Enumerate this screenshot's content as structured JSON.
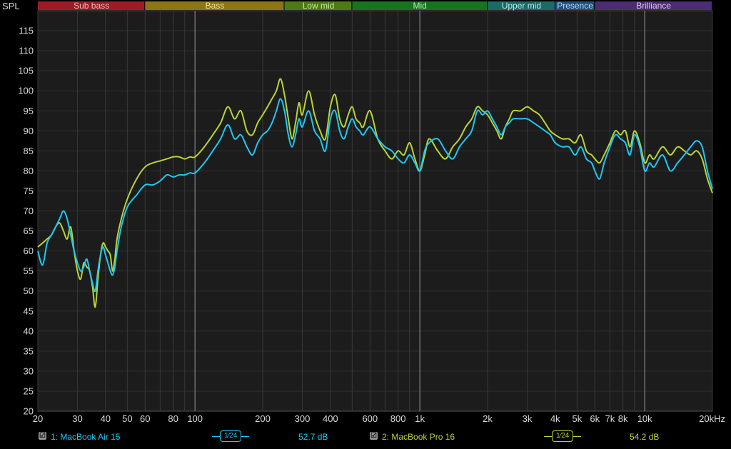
{
  "colors": {
    "series1": "#1fc7f5",
    "series2": "#b8d433",
    "background": "#000000",
    "plot_background": "#1c1c1c",
    "axis_text": "#d8d8d8"
  },
  "bands": [
    {
      "label": "Sub bass",
      "from": 20,
      "to": 60,
      "color": "#9e1a26",
      "text_color": "#e3c0c0"
    },
    {
      "label": "Bass",
      "from": 60,
      "to": 250,
      "color": "#8b7514",
      "text_color": "#f0e1a0"
    },
    {
      "label": "Low mid",
      "from": 250,
      "to": 500,
      "color": "#4e7a14",
      "text_color": "#cfe4a8"
    },
    {
      "label": "Mid",
      "from": 500,
      "to": 2000,
      "color": "#17741f",
      "text_color": "#bfe5c1"
    },
    {
      "label": "Upper mid",
      "from": 2000,
      "to": 4000,
      "color": "#1b6a66",
      "text_color": "#bfe6e4"
    },
    {
      "label": "Presence",
      "from": 4000,
      "to": 6000,
      "color": "#1f4e7e",
      "text_color": "#c3d8ef"
    },
    {
      "label": "Brilliance",
      "from": 6000,
      "to": 20000,
      "color": "#4a2d72",
      "text_color": "#d9c9ee"
    }
  ],
  "legend": {
    "items": [
      {
        "checkbox": "☑",
        "name": "1: MacBook Air 15",
        "smoothing_num": "1",
        "smoothing_den": "24",
        "value": "52.7 dB"
      },
      {
        "checkbox": "☑",
        "name": "2: MacBook Pro 16",
        "smoothing_num": "1",
        "smoothing_den": "24",
        "value": "54.2 dB"
      }
    ]
  },
  "chart_data": {
    "type": "line",
    "ylabel": "SPL",
    "xscale": "log",
    "xlim": [
      20,
      20000
    ],
    "ylim": [
      20,
      120
    ],
    "grid": true,
    "x_tick_labels": [
      {
        "x": 20,
        "label": "20"
      },
      {
        "x": 30,
        "label": "30"
      },
      {
        "x": 40,
        "label": "40"
      },
      {
        "x": 50,
        "label": "50"
      },
      {
        "x": 60,
        "label": "60"
      },
      {
        "x": 80,
        "label": "80"
      },
      {
        "x": 100,
        "label": "100"
      },
      {
        "x": 200,
        "label": "200"
      },
      {
        "x": 300,
        "label": "300"
      },
      {
        "x": 400,
        "label": "400"
      },
      {
        "x": 600,
        "label": "600"
      },
      {
        "x": 800,
        "label": "800"
      },
      {
        "x": 1000,
        "label": "1k"
      },
      {
        "x": 2000,
        "label": "2k"
      },
      {
        "x": 3000,
        "label": "3k"
      },
      {
        "x": 4000,
        "label": "4k"
      },
      {
        "x": 5000,
        "label": "5k"
      },
      {
        "x": 6000,
        "label": "6k"
      },
      {
        "x": 7000,
        "label": "7k"
      },
      {
        "x": 8000,
        "label": "8k"
      },
      {
        "x": 10000,
        "label": "10k"
      },
      {
        "x": 20000,
        "label": "20kHz"
      }
    ],
    "y_ticks": [
      20,
      25,
      30,
      35,
      40,
      45,
      50,
      55,
      60,
      65,
      70,
      75,
      80,
      85,
      90,
      95,
      100,
      105,
      110,
      115
    ],
    "series": [
      {
        "name": "1: MacBook Air 15",
        "color": "#1fc7f5",
        "points": [
          [
            20,
            60
          ],
          [
            21,
            56.5
          ],
          [
            22,
            62
          ],
          [
            23,
            64
          ],
          [
            24,
            66
          ],
          [
            25,
            68
          ],
          [
            26,
            70
          ],
          [
            27,
            68
          ],
          [
            28,
            64
          ],
          [
            29,
            60
          ],
          [
            30,
            57
          ],
          [
            31,
            55
          ],
          [
            32,
            56
          ],
          [
            33,
            58
          ],
          [
            34,
            55
          ],
          [
            35,
            52
          ],
          [
            36,
            50
          ],
          [
            37,
            55
          ],
          [
            38,
            59
          ],
          [
            39,
            61
          ],
          [
            40,
            59
          ],
          [
            41,
            57
          ],
          [
            42,
            55
          ],
          [
            43,
            54
          ],
          [
            44,
            56
          ],
          [
            45,
            60
          ],
          [
            47,
            66
          ],
          [
            50,
            71
          ],
          [
            55,
            74
          ],
          [
            60,
            76.5
          ],
          [
            65,
            76.5
          ],
          [
            70,
            77.5
          ],
          [
            75,
            79
          ],
          [
            80,
            78.5
          ],
          [
            85,
            79
          ],
          [
            90,
            79
          ],
          [
            95,
            79.5
          ],
          [
            100,
            79.5
          ],
          [
            110,
            82
          ],
          [
            120,
            85
          ],
          [
            130,
            88
          ],
          [
            140,
            91.5
          ],
          [
            150,
            88
          ],
          [
            160,
            89
          ],
          [
            170,
            86
          ],
          [
            180,
            84
          ],
          [
            190,
            87
          ],
          [
            200,
            89
          ],
          [
            210,
            90
          ],
          [
            220,
            92
          ],
          [
            230,
            95
          ],
          [
            240,
            98
          ],
          [
            250,
            95
          ],
          [
            260,
            89
          ],
          [
            270,
            86
          ],
          [
            280,
            89
          ],
          [
            290,
            93
          ],
          [
            300,
            91
          ],
          [
            320,
            95
          ],
          [
            340,
            90
          ],
          [
            360,
            88
          ],
          [
            380,
            85
          ],
          [
            400,
            93
          ],
          [
            420,
            95
          ],
          [
            440,
            90
          ],
          [
            460,
            88
          ],
          [
            480,
            91
          ],
          [
            500,
            93
          ],
          [
            520,
            91
          ],
          [
            540,
            90
          ],
          [
            560,
            89
          ],
          [
            600,
            91
          ],
          [
            650,
            88
          ],
          [
            700,
            86
          ],
          [
            750,
            85
          ],
          [
            800,
            83
          ],
          [
            850,
            82
          ],
          [
            900,
            84
          ],
          [
            950,
            82
          ],
          [
            1000,
            80
          ],
          [
            1050,
            85
          ],
          [
            1100,
            87
          ],
          [
            1200,
            88
          ],
          [
            1300,
            85
          ],
          [
            1400,
            83
          ],
          [
            1500,
            86
          ],
          [
            1600,
            88
          ],
          [
            1700,
            90
          ],
          [
            1800,
            95
          ],
          [
            1900,
            94
          ],
          [
            2000,
            95
          ],
          [
            2100,
            93
          ],
          [
            2200,
            91
          ],
          [
            2300,
            89
          ],
          [
            2400,
            91
          ],
          [
            2500,
            92
          ],
          [
            2600,
            93
          ],
          [
            2800,
            93
          ],
          [
            3000,
            93
          ],
          [
            3200,
            92
          ],
          [
            3400,
            91
          ],
          [
            3600,
            90
          ],
          [
            3800,
            89
          ],
          [
            4000,
            87
          ],
          [
            4300,
            86
          ],
          [
            4600,
            86
          ],
          [
            4900,
            84
          ],
          [
            5200,
            86
          ],
          [
            5500,
            83
          ],
          [
            5800,
            82
          ],
          [
            6000,
            80
          ],
          [
            6300,
            78
          ],
          [
            6600,
            82
          ],
          [
            7000,
            86
          ],
          [
            7400,
            89
          ],
          [
            7800,
            88
          ],
          [
            8200,
            87
          ],
          [
            8600,
            84
          ],
          [
            9000,
            89
          ],
          [
            9500,
            86
          ],
          [
            10000,
            80
          ],
          [
            10500,
            82
          ],
          [
            11000,
            81
          ],
          [
            12000,
            84
          ],
          [
            13000,
            80
          ],
          [
            14000,
            82
          ],
          [
            15000,
            84
          ],
          [
            16000,
            86
          ],
          [
            17000,
            87.5
          ],
          [
            18000,
            86
          ],
          [
            19000,
            80
          ],
          [
            20000,
            75.5
          ]
        ]
      },
      {
        "name": "2: MacBook Pro 16",
        "color": "#b8d433",
        "points": [
          [
            20,
            61
          ],
          [
            21,
            62
          ],
          [
            22,
            63
          ],
          [
            23,
            64
          ],
          [
            24,
            66
          ],
          [
            25,
            67
          ],
          [
            26,
            65
          ],
          [
            27,
            63
          ],
          [
            28,
            66
          ],
          [
            29,
            60
          ],
          [
            30,
            55
          ],
          [
            31,
            53
          ],
          [
            32,
            57
          ],
          [
            33,
            56
          ],
          [
            34,
            55
          ],
          [
            35,
            51
          ],
          [
            36,
            46
          ],
          [
            37,
            53
          ],
          [
            38,
            59
          ],
          [
            39,
            62
          ],
          [
            40,
            61
          ],
          [
            41,
            60
          ],
          [
            42,
            59
          ],
          [
            43,
            55
          ],
          [
            44,
            58
          ],
          [
            45,
            63
          ],
          [
            47,
            68
          ],
          [
            50,
            73
          ],
          [
            55,
            78
          ],
          [
            60,
            81
          ],
          [
            65,
            82
          ],
          [
            70,
            82.5
          ],
          [
            75,
            83
          ],
          [
            80,
            83.5
          ],
          [
            85,
            83.5
          ],
          [
            90,
            83
          ],
          [
            95,
            83.5
          ],
          [
            100,
            83.5
          ],
          [
            110,
            86
          ],
          [
            120,
            89
          ],
          [
            130,
            92
          ],
          [
            140,
            96
          ],
          [
            150,
            93
          ],
          [
            160,
            95
          ],
          [
            170,
            90
          ],
          [
            180,
            89
          ],
          [
            190,
            92
          ],
          [
            200,
            94
          ],
          [
            210,
            96
          ],
          [
            220,
            98
          ],
          [
            230,
            100
          ],
          [
            240,
            103
          ],
          [
            250,
            99
          ],
          [
            260,
            93
          ],
          [
            270,
            88
          ],
          [
            280,
            92
          ],
          [
            290,
            97
          ],
          [
            300,
            94
          ],
          [
            320,
            100
          ],
          [
            340,
            94
          ],
          [
            360,
            90
          ],
          [
            380,
            88
          ],
          [
            400,
            96
          ],
          [
            420,
            99
          ],
          [
            440,
            93
          ],
          [
            460,
            91
          ],
          [
            480,
            94
          ],
          [
            500,
            96
          ],
          [
            520,
            93
          ],
          [
            540,
            92
          ],
          [
            560,
            91
          ],
          [
            600,
            95
          ],
          [
            650,
            88
          ],
          [
            700,
            85
          ],
          [
            750,
            83
          ],
          [
            800,
            85
          ],
          [
            850,
            84
          ],
          [
            900,
            87
          ],
          [
            950,
            83
          ],
          [
            1000,
            80
          ],
          [
            1050,
            84
          ],
          [
            1100,
            88
          ],
          [
            1200,
            85
          ],
          [
            1300,
            83
          ],
          [
            1400,
            86
          ],
          [
            1500,
            88
          ],
          [
            1600,
            91
          ],
          [
            1700,
            93
          ],
          [
            1800,
            96
          ],
          [
            1900,
            95
          ],
          [
            2000,
            94
          ],
          [
            2100,
            92
          ],
          [
            2200,
            90
          ],
          [
            2300,
            88
          ],
          [
            2400,
            91
          ],
          [
            2500,
            93
          ],
          [
            2600,
            95
          ],
          [
            2800,
            95
          ],
          [
            3000,
            96
          ],
          [
            3200,
            95
          ],
          [
            3400,
            94
          ],
          [
            3600,
            92
          ],
          [
            3800,
            90
          ],
          [
            4000,
            89
          ],
          [
            4300,
            88
          ],
          [
            4600,
            88
          ],
          [
            4900,
            87
          ],
          [
            5200,
            89
          ],
          [
            5500,
            85
          ],
          [
            5800,
            84
          ],
          [
            6000,
            83
          ],
          [
            6300,
            82
          ],
          [
            6600,
            84
          ],
          [
            7000,
            87
          ],
          [
            7400,
            90
          ],
          [
            7800,
            89
          ],
          [
            8200,
            90
          ],
          [
            8600,
            86
          ],
          [
            9000,
            90
          ],
          [
            9500,
            87
          ],
          [
            10000,
            82
          ],
          [
            10500,
            84
          ],
          [
            11000,
            83
          ],
          [
            12000,
            86
          ],
          [
            13000,
            84
          ],
          [
            14000,
            86
          ],
          [
            15000,
            85
          ],
          [
            16000,
            84
          ],
          [
            17000,
            85
          ],
          [
            18000,
            83
          ],
          [
            19000,
            78
          ],
          [
            20000,
            74.5
          ]
        ]
      }
    ]
  }
}
